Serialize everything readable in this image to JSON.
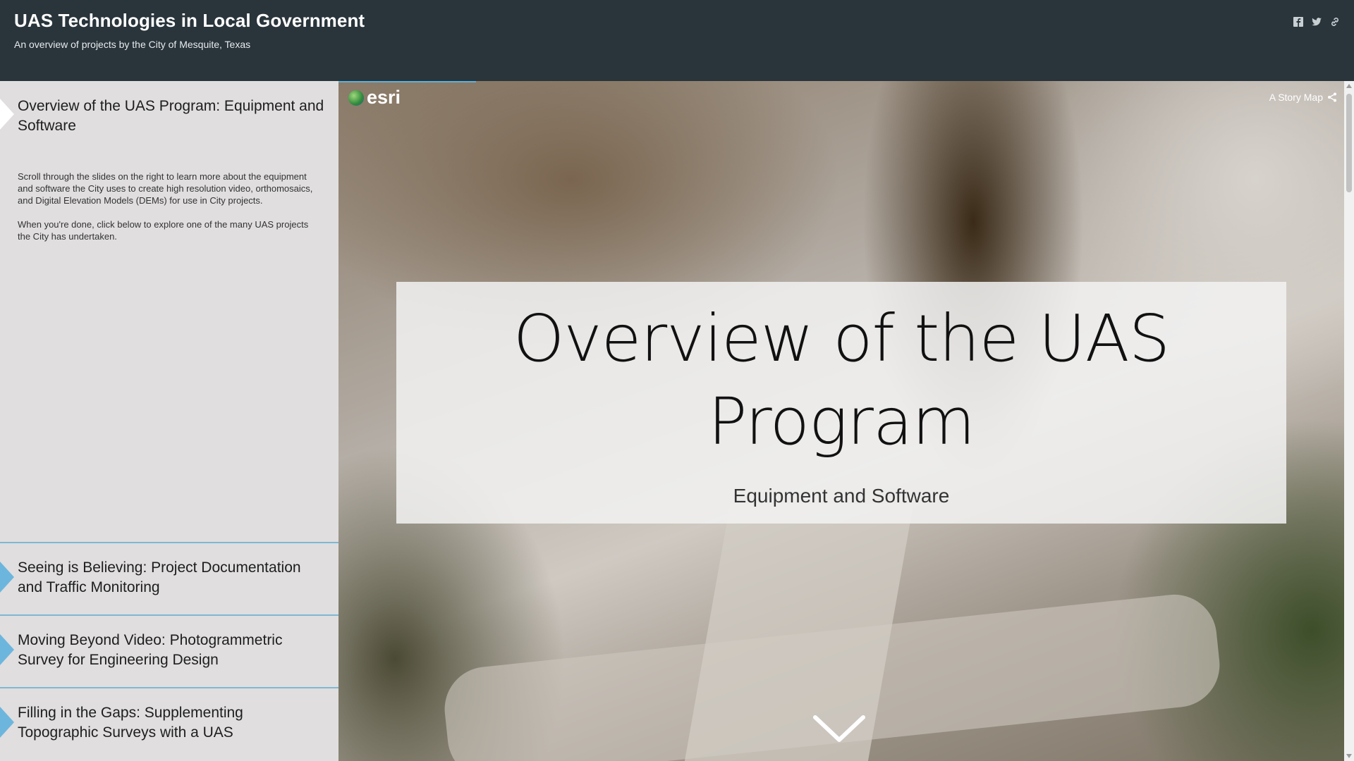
{
  "header": {
    "title": "UAS Technologies in Local Government",
    "subtitle": "An overview of projects by the City of Mesquite, Texas",
    "share_icons": [
      "facebook-icon",
      "twitter-icon",
      "link-icon"
    ]
  },
  "sidebar": {
    "sections": [
      {
        "title": "Overview of the UAS Program: Equipment and Software",
        "active": true,
        "paragraphs": [
          "Scroll through the slides on the right to learn more about the equipment and software the City uses to create high resolution video, orthomosaics, and Digital Elevation Models (DEMs) for use in City projects.",
          "When you're done, click below to explore one of the many UAS projects the City has undertaken."
        ]
      },
      {
        "title": "Seeing is Believing: Project Documentation and Traffic Monitoring",
        "active": false
      },
      {
        "title": "Moving Beyond Video: Photogrammetric Survey for Engineering Design",
        "active": false
      },
      {
        "title": "Filling in the Gaps: Supplementing Topographic Surveys with a UAS",
        "active": false
      }
    ]
  },
  "stage": {
    "logo_text": "esri",
    "storymap_label": "A Story Map",
    "overlay_title": "Overview of the UAS Program",
    "overlay_subtitle": "Equipment and Software"
  },
  "colors": {
    "header_bg": "#29343b",
    "sidebar_bg": "#e0dedf",
    "accent": "#6cb6de"
  }
}
